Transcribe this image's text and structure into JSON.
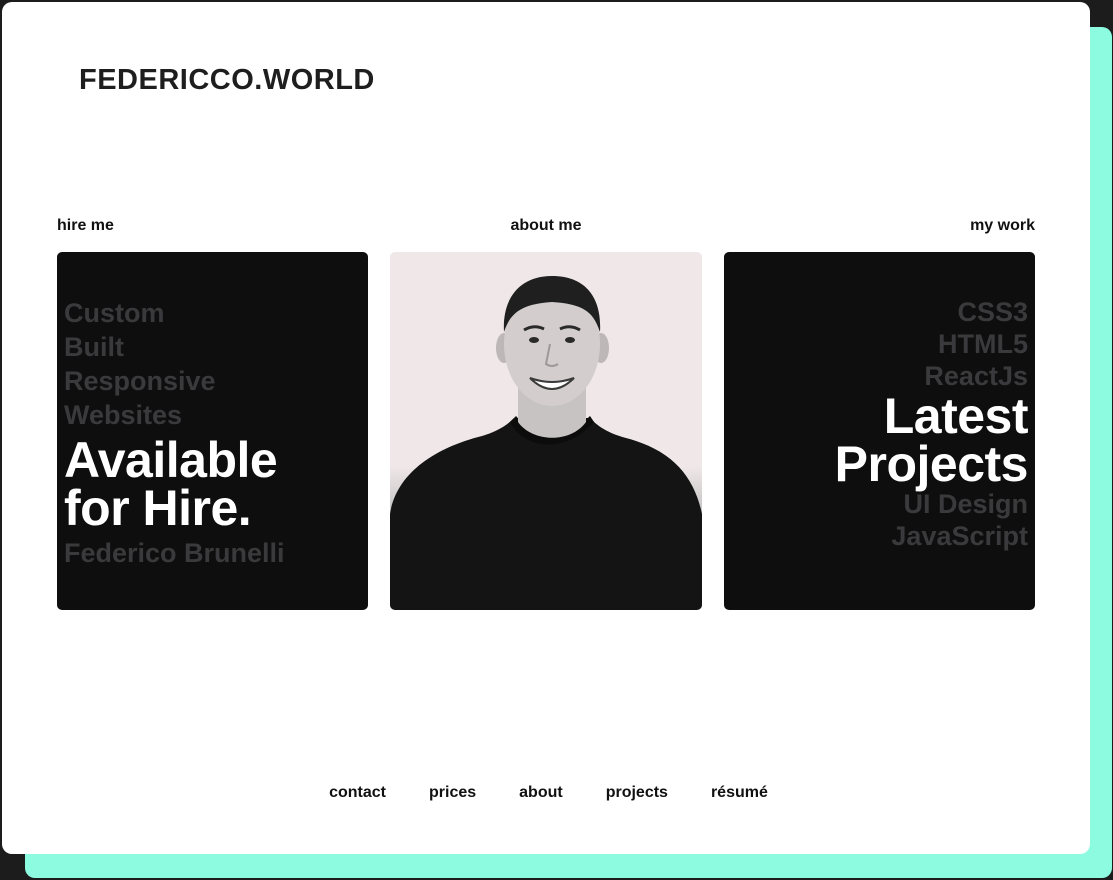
{
  "site": {
    "logo": "FEDERICCO.WORLD"
  },
  "columns": {
    "hire_label": "hire me",
    "about_label": "about me",
    "work_label": "my work"
  },
  "hire_card": {
    "dim_lines": [
      "Custom",
      "Built",
      "Responsive",
      "Websites"
    ],
    "headline_lines": [
      "Available",
      "for Hire."
    ],
    "name": "Federico Brunelli"
  },
  "work_card": {
    "dim_top": [
      "CSS3",
      "HTML5",
      "ReactJs"
    ],
    "headline_lines": [
      "Latest",
      "Projects"
    ],
    "dim_bottom": [
      "UI Design",
      "JavaScript"
    ]
  },
  "nav": {
    "items": [
      "contact",
      "prices",
      "about",
      "projects",
      "résumé"
    ]
  },
  "colors": {
    "accent": "#8cfbe0",
    "card_bg": "#0e0e0e",
    "dim_text": "#3a3a3c",
    "page_bg": "#ffffff"
  }
}
